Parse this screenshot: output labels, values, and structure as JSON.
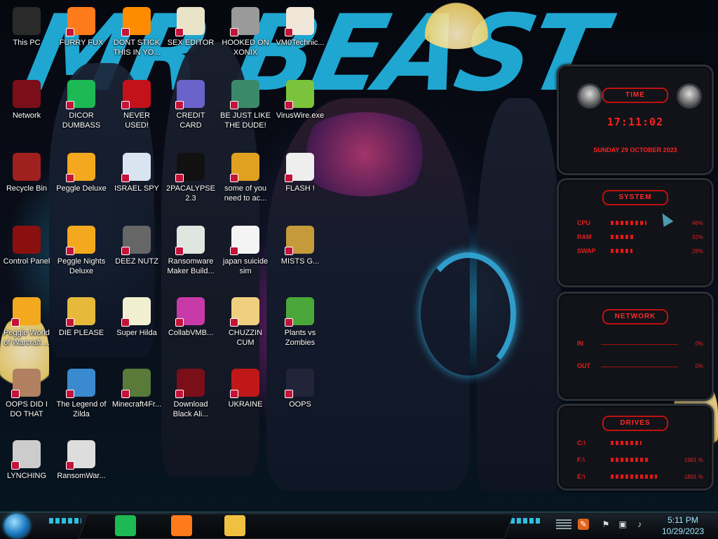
{
  "wallpaper": {
    "text": "MR BEAST"
  },
  "desktop_icons": [
    {
      "label": "This PC",
      "icon": "this-pc-icon",
      "color": "#2a2a2a"
    },
    {
      "label": "FURRY FUX",
      "icon": "firefox-icon",
      "color": "#ff7a1a"
    },
    {
      "label": "DONT STICK THIS IN YO...",
      "icon": "vlc-cone-icon",
      "color": "#ff8c00"
    },
    {
      "label": "SEX EDITOR",
      "icon": "hxd-editor-icon",
      "color": "#e9e3c8"
    },
    {
      "label": "HOOKED ON XONIX",
      "icon": "xonix-game-icon",
      "color": "#9a9a9a"
    },
    {
      "label": "VM0Technic...",
      "icon": "technician-avatar-icon",
      "color": "#f0e6d8"
    },
    {
      "label": "Network",
      "icon": "network-orb-icon",
      "color": "#7a0f1a"
    },
    {
      "label": "DICOR DUMBASS",
      "icon": "discord-green-icon",
      "color": "#1db954"
    },
    {
      "label": "NEVER USED!",
      "icon": "dev-cpp-icon",
      "color": "#c4121a"
    },
    {
      "label": "CREDIT CARD CHECKER",
      "icon": "credit-card-icon",
      "color": "#6a63c9"
    },
    {
      "label": "BE JUST LIKE THE DUDE!",
      "icon": "santa-orb-icon",
      "color": "#3a8a6a"
    },
    {
      "label": "VirusWire.exe",
      "icon": "lime-icon",
      "color": "#7bc33a"
    },
    {
      "label": "Recycle Bin",
      "icon": "recycle-bin-icon",
      "color": "#a02020"
    },
    {
      "label": "Peggle Deluxe",
      "icon": "peggle-icon",
      "color": "#f3a81d"
    },
    {
      "label": "ISRAEL SPY",
      "icon": "spy-window-icon",
      "color": "#d8e4f0"
    },
    {
      "label": "2PACALYPSE 2.3",
      "icon": "terminal-icon",
      "color": "#111111"
    },
    {
      "label": "some of you need to ac...",
      "icon": "cartoon-bear-icon",
      "color": "#e0a020"
    },
    {
      "label": "FLASH !",
      "icon": "flash-doc-icon",
      "color": "#eeeeee"
    },
    {
      "label": "Control Panel",
      "icon": "control-panel-icon",
      "color": "#8a1010"
    },
    {
      "label": "Peggle Nights Deluxe",
      "icon": "peggle-nights-icon",
      "color": "#f3a81d"
    },
    {
      "label": "DEEZ NUTZ",
      "icon": "stacked-windows-icon",
      "color": "#666666"
    },
    {
      "label": "Ransomware Maker Build...",
      "icon": "app-window-icon",
      "color": "#dfe6df"
    },
    {
      "label": "japan suicide sim",
      "icon": "document-icon",
      "color": "#f4f4f4"
    },
    {
      "label": "MISTS G...",
      "icon": "money-bag-icon",
      "color": "#c49a3a"
    },
    {
      "label": "Peggle World of Warcraft ...",
      "icon": "peggle-wow-icon",
      "color": "#f3a81d"
    },
    {
      "label": "DIE PLEASE",
      "icon": "de-icon",
      "color": "#e6b93a"
    },
    {
      "label": "Super Hilda",
      "icon": "pixel-sprite-icon",
      "color": "#f0f0d0"
    },
    {
      "label": "CollabVMB...",
      "icon": "collab-monitor-icon",
      "color": "#c83aa8"
    },
    {
      "label": "CHUZZIN CUM",
      "icon": "cartoon-character-icon",
      "color": "#f0d080"
    },
    {
      "label": "Plants vs Zombies",
      "icon": "plant-icon",
      "color": "#4aa83a"
    },
    {
      "label": "OOPS DID I DO THAT",
      "icon": "portrait-icon",
      "color": "#b08060"
    },
    {
      "label": "The Legend of Zilda",
      "icon": "pixel-hero-icon",
      "color": "#3a8ad0"
    },
    {
      "label": "Minecraft4Fr...",
      "icon": "minecraft-block-icon",
      "color": "#5a7a3a"
    },
    {
      "label": "Download Black Ali...",
      "icon": "alien-orb-icon",
      "color": "#7a0f1a"
    },
    {
      "label": "UKRAINE",
      "icon": "radiation-icon",
      "color": "#c01818"
    },
    {
      "label": "OOPS",
      "icon": "dark-card-icon",
      "color": "#22243a"
    },
    {
      "label": "LYNCHING",
      "icon": "rope-icon",
      "color": "#cccccc"
    },
    {
      "label": "RansomWar...",
      "icon": "skull-icon",
      "color": "#dddddd"
    }
  ],
  "widgets": {
    "time": {
      "title": "TIME",
      "clock": "17:11:02",
      "date": "SUNDAY 29 OCTOBER 2023"
    },
    "system": {
      "title": "SYSTEM",
      "rows": [
        {
          "label": "CPU",
          "value": "46%",
          "fraction": 0.46
        },
        {
          "label": "RAM",
          "value": "32%",
          "fraction": 0.32
        },
        {
          "label": "SWAP",
          "value": "28%",
          "fraction": 0.28
        }
      ]
    },
    "network": {
      "title": "NETWORK",
      "rows": [
        {
          "label": "IN",
          "value": "0%"
        },
        {
          "label": "OUT",
          "value": "0%"
        }
      ]
    },
    "drives": {
      "title": "DRIVES",
      "rows": [
        {
          "label": "C:\\",
          "value": ""
        },
        {
          "label": "F:\\",
          "value": "1981 %"
        },
        {
          "label": "E:\\",
          "value": "1891 %"
        }
      ]
    }
  },
  "taskbar": {
    "pinned": [
      {
        "name": "spotify",
        "icon": "spotify-icon",
        "color": "#1db954"
      },
      {
        "name": "firefox",
        "icon": "firefox-icon",
        "color": "#ff7a1a"
      },
      {
        "name": "file-explorer",
        "icon": "folder-icon",
        "color": "#f0c040"
      }
    ],
    "tray": {
      "time": "5:11 PM",
      "date": "10/29/2023"
    },
    "accent": "#2ec0e0"
  }
}
